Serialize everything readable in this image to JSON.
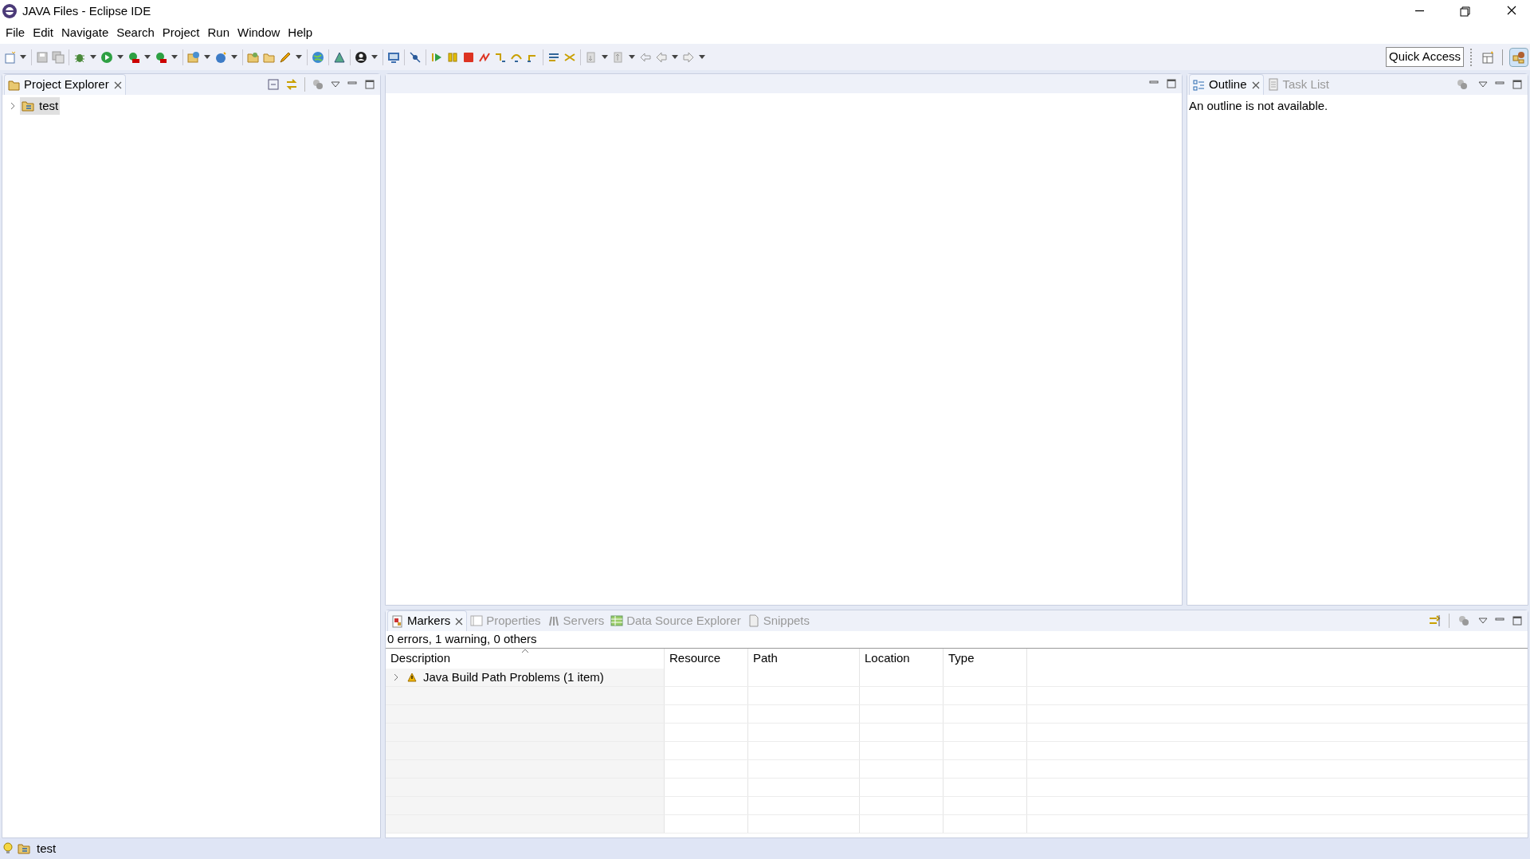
{
  "window": {
    "title": "JAVA Files - Eclipse IDE"
  },
  "menu": [
    "File",
    "Edit",
    "Navigate",
    "Search",
    "Project",
    "Run",
    "Window",
    "Help"
  ],
  "toolbar": {
    "quick_access": "Quick Access"
  },
  "project_explorer": {
    "tabs": [
      {
        "label": "Project Explorer",
        "selected": true
      }
    ],
    "tree": [
      {
        "label": "test",
        "expanded": false,
        "selected": true
      }
    ]
  },
  "outline": {
    "tabs": [
      {
        "label": "Outline",
        "selected": true
      },
      {
        "label": "Task List",
        "selected": false
      }
    ],
    "message": "An outline is not available."
  },
  "markers": {
    "tabs": [
      {
        "label": "Markers",
        "selected": true
      },
      {
        "label": "Properties",
        "selected": false
      },
      {
        "label": "Servers",
        "selected": false
      },
      {
        "label": "Data Source Explorer",
        "selected": false
      },
      {
        "label": "Snippets",
        "selected": false
      }
    ],
    "summary": "0 errors, 1 warning, 0 others",
    "columns": [
      "Description",
      "Resource",
      "Path",
      "Location",
      "Type"
    ],
    "rows": [
      {
        "description": "Java Build Path Problems (1 item)",
        "expanded": false
      }
    ]
  },
  "status_bar": {
    "item": "test"
  }
}
